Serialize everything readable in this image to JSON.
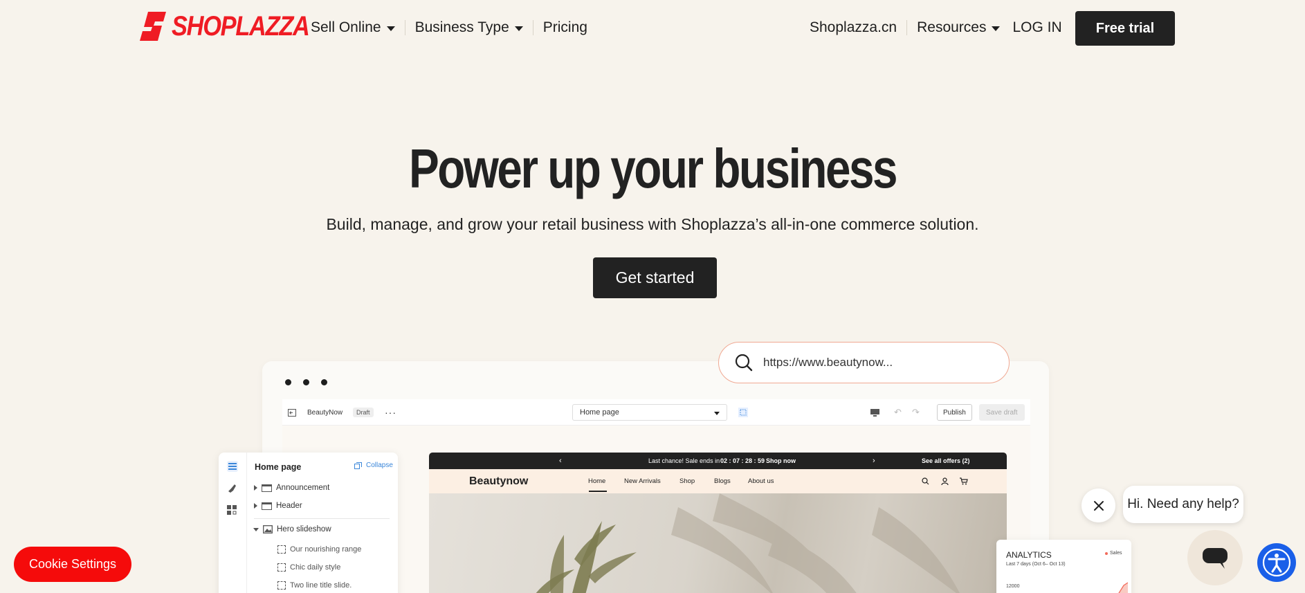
{
  "brand": {
    "name": "SHOPLAZZA",
    "color": "#ef1c24"
  },
  "nav": {
    "left": [
      {
        "label": "Sell Online",
        "dropdown": true
      },
      {
        "label": "Business Type",
        "dropdown": true
      },
      {
        "label": "Pricing",
        "dropdown": false
      }
    ],
    "right": {
      "cn_label": "Shoplazza.cn",
      "resources_label": "Resources",
      "login_label": "LOG IN",
      "trial_label": "Free trial"
    }
  },
  "hero": {
    "title": "Power up your business",
    "subtitle": "Build, manage, and grow your retail business with Shoplazza’s all-in-one commerce solution.",
    "cta": "Get started"
  },
  "mock": {
    "url": "https://www.beautynow...",
    "editor": {
      "store": "BeautyNow",
      "status": "Draft",
      "page": "Home page",
      "publish": "Publish",
      "save_draft": "Save draft"
    },
    "panel": {
      "title": "Home page",
      "collapse": "Collapse",
      "items": [
        "Announcement",
        "Header",
        "Hero slideshow"
      ],
      "slides": [
        "Our nourishing range",
        "Chic daily style",
        "Two line title slide."
      ]
    },
    "site": {
      "announcement": "Last chance! Sale ends in",
      "countdown": "02 : 07 : 28 : 59",
      "shop_now": "Shop now",
      "see_offers": "See  all offers (2)",
      "brand": "Beautynow",
      "menu": [
        "Home",
        "New Arrivals",
        "Shop",
        "Blogs",
        "About us"
      ]
    },
    "analytics": {
      "title": "ANALYTICS",
      "subtitle": "Last 7 days (Oct 6– Oct 13)",
      "legend": "Sales",
      "y_tick": "12000"
    }
  },
  "chat": {
    "prompt": "Hi. Need any help?"
  },
  "cookie": {
    "label": "Cookie Settings"
  }
}
